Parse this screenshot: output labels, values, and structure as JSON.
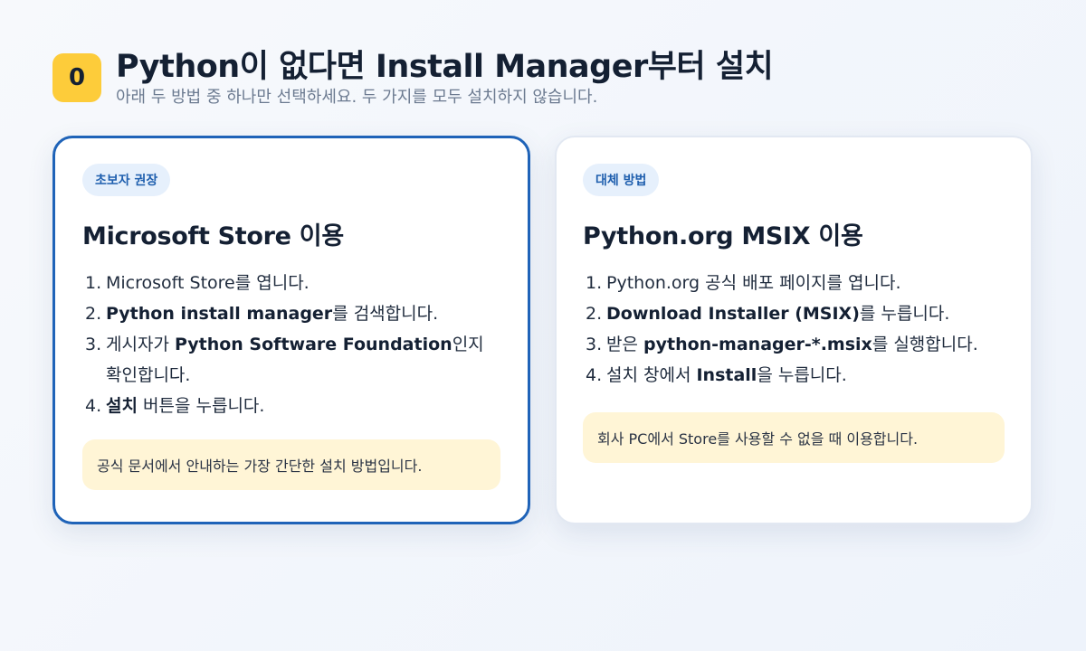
{
  "header": {
    "step_number": "0",
    "title": "Python이 없다면 Install Manager부터 설치",
    "subtitle": "아래 두 방법 중 하나만 선택하세요. 두 가지를 모두 설치하지 않습니다."
  },
  "card_store": {
    "badge": "초보자 권장",
    "title": "Microsoft Store 이용",
    "steps": [
      {
        "num": "1.",
        "pre": "Microsoft Store를 엽니다.",
        "bold": "",
        "post": ""
      },
      {
        "num": "2.",
        "pre": "",
        "bold": "Python install manager",
        "post": "를 검색합니다."
      },
      {
        "num": "3.",
        "pre": "게시자가 ",
        "bold": "Python Software Foundation",
        "post": "인지 확인합니다."
      },
      {
        "num": "4.",
        "pre": "",
        "bold": "설치",
        "post": " 버튼을 누릅니다."
      }
    ],
    "note": "공식 문서에서 안내하는 가장 간단한 설치 방법입니다."
  },
  "card_msix": {
    "badge": "대체 방법",
    "title": "Python.org MSIX 이용",
    "steps": [
      {
        "num": "1.",
        "pre": "Python.org 공식 배포 페이지를 엽니다.",
        "bold": "",
        "post": ""
      },
      {
        "num": "2.",
        "pre": "",
        "bold": "Download Installer (MSIX)",
        "post": "를 누릅니다."
      },
      {
        "num": "3.",
        "pre": "받은 ",
        "bold": "python-manager-*.msix",
        "post": "를 실행합니다."
      },
      {
        "num": "4.",
        "pre": "설치 창에서 ",
        "bold": "Install",
        "post": "을 누릅니다."
      }
    ],
    "note": "회사 PC에서 Store를 사용할 수 없을 때 이용합니다."
  },
  "colors": {
    "accent": "#1f63b8",
    "step_badge": "#fdcc3a",
    "note_bg": "#fff5d6",
    "pill_bg": "#e6f0fc"
  }
}
